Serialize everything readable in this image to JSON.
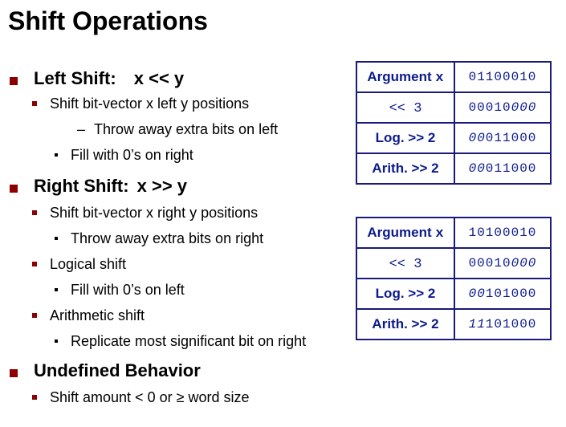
{
  "title": "Shift Operations",
  "bullets": {
    "left_shift_heading": "Left Shift:",
    "left_shift_expr": "x << y",
    "left_shift_item": [
      "Shift bit-vector ",
      "x",
      " left ",
      "y",
      " positions"
    ],
    "throw_left": "Throw away extra bits on left",
    "fill_right": "Fill with 0’s on right",
    "right_shift_heading": "Right Shift:",
    "right_shift_expr": "x >> y",
    "right_shift_item": [
      "Shift bit-vector ",
      "x",
      " right ",
      "y",
      " positions"
    ],
    "throw_right": "Throw away extra bits on right",
    "logical": "Logical shift",
    "fill_left": "Fill with 0’s on left",
    "arith": "Arithmetic shift",
    "replicate": "Replicate most significant bit on right",
    "undefined_heading": "Undefined Behavior",
    "undefined_item": "Shift amount < 0 or ≥ word size"
  },
  "table1": {
    "rows": [
      {
        "label_pre": "Argument ",
        "label_code": "x",
        "plain": "01100010",
        "ital": ""
      },
      {
        "label_pre": "<< 3",
        "label_code": "",
        "plain": "00010",
        "ital": "000"
      },
      {
        "label_pre": "Log. >> 2",
        "label_code": "",
        "plain": "011000",
        "ital": "00",
        "ital_first": true
      },
      {
        "label_pre": "Arith. >> 2",
        "label_code": "",
        "plain": "011000",
        "ital": "00",
        "ital_first": true
      }
    ]
  },
  "table2": {
    "rows": [
      {
        "label_pre": "Argument ",
        "label_code": "x",
        "plain": "10100010",
        "ital": ""
      },
      {
        "label_pre": "<< 3",
        "label_code": "",
        "plain": "00010",
        "ital": "000"
      },
      {
        "label_pre": "Log. >> 2",
        "label_code": "",
        "plain": "101000",
        "ital": "00",
        "ital_first": true
      },
      {
        "label_pre": "Arith. >> 2",
        "label_code": "",
        "plain": "101000",
        "ital": "11",
        "ital_first": true
      }
    ]
  },
  "colors": {
    "bullet": "#8b0000",
    "table_text": "#0b1a8c",
    "table_border": "#1a1a7a"
  }
}
